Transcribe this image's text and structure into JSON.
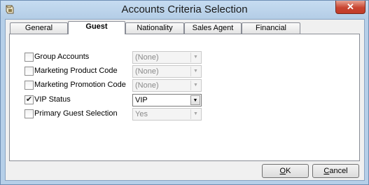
{
  "window": {
    "title": "Accounts Criteria Selection",
    "close_label": "✕"
  },
  "tabs": [
    {
      "label": "General"
    },
    {
      "label": "Guest"
    },
    {
      "label": "Nationality"
    },
    {
      "label": "Sales Agent"
    },
    {
      "label": "Financial"
    }
  ],
  "active_tab": "Guest",
  "criteria": [
    {
      "label": "Group Accounts",
      "checked": false,
      "check_mark": "",
      "value": "(None)",
      "enabled": false
    },
    {
      "label": "Marketing Product Code",
      "checked": false,
      "check_mark": "",
      "value": "(None)",
      "enabled": false
    },
    {
      "label": "Marketing Promotion Code",
      "checked": false,
      "check_mark": "",
      "value": "(None)",
      "enabled": false
    },
    {
      "label": "VIP Status",
      "checked": true,
      "check_mark": "✔",
      "value": "VIP",
      "enabled": true
    },
    {
      "label": "Primary Guest Selection",
      "checked": false,
      "check_mark": "",
      "value": "Yes",
      "enabled": false
    }
  ],
  "buttons": {
    "ok": {
      "accel": "O",
      "rest": "K"
    },
    "cancel": {
      "accel": "C",
      "rest": "ancel"
    }
  },
  "icons": {
    "dropdown": "▼"
  },
  "colors": {
    "title_bar": "#b5cfe8",
    "close_button": "#c84531",
    "panel": "#ffffff"
  }
}
